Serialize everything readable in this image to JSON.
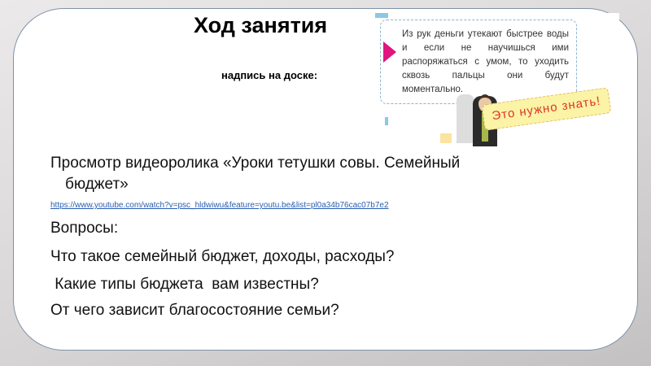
{
  "slide": {
    "title": "Ход занятия",
    "subtitle": "надпись на доске:",
    "picture": {
      "quote": "Из рук деньги утекают быстрее воды и если не научишься ими распоряжаться с умом, то уходить сквозь пальцы они будут моментально.",
      "badge": "Это нужно знать!"
    },
    "video_line1": "Просмотр видеоролика «Уроки тетушки совы. Семейный",
    "video_line2": "бюджет»",
    "link": "https://www.youtube.com/watch?v=psc_hldwiwu&feature=youtu.be&list=pl0a34b76cac07b7e2",
    "questions_label": "Вопросы:",
    "questions": [
      "Что такое семейный бюджет, доходы, расходы?",
      " Какие типы бюджета  вам известны?",
      "От чего зависит благосостояние семьи?"
    ]
  }
}
